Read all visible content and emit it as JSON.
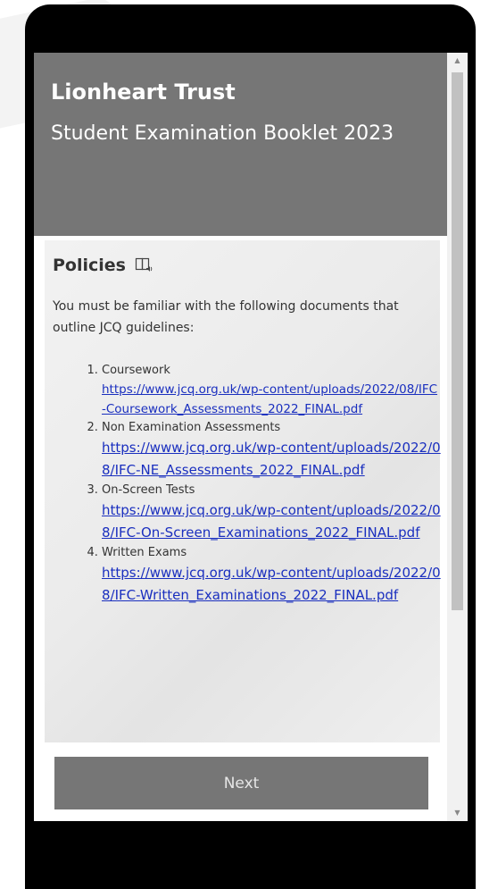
{
  "header": {
    "org_title": "Lionheart Trust",
    "booklet_title": "Student Examination Booklet 2023"
  },
  "policies": {
    "heading": "Policies",
    "reader_icon": "immersive-reader-icon",
    "intro": "You must be familiar with the following documents that outline JCQ guidelines:",
    "items": [
      {
        "label": "Coursework",
        "url": "https://www.jcq.org.uk/wp-content/uploads/2022/08/IFC-Coursework_Assessments_2022_FINAL.pdf"
      },
      {
        "label": "Non Examination Assessments",
        "url": "https://www.jcq.org.uk/wp-content/uploads/2022/08/IFC-NE_Assessments_2022_FINAL.pdf"
      },
      {
        "label": "On-Screen Tests",
        "url": "https://www.jcq.org.uk/wp-content/uploads/2022/08/IFC-On-Screen_Examinations_2022_FINAL.pdf"
      },
      {
        "label": "Written Exams",
        "url": "https://www.jcq.org.uk/wp-content/uploads/2022/08/IFC-Written_Examinations_2022_FINAL.pdf"
      }
    ]
  },
  "next_button": {
    "label": "Next"
  },
  "colors": {
    "header_bg": "#767676",
    "button_bg": "#767676",
    "link": "#1a2fbf",
    "frame": "#000000"
  }
}
